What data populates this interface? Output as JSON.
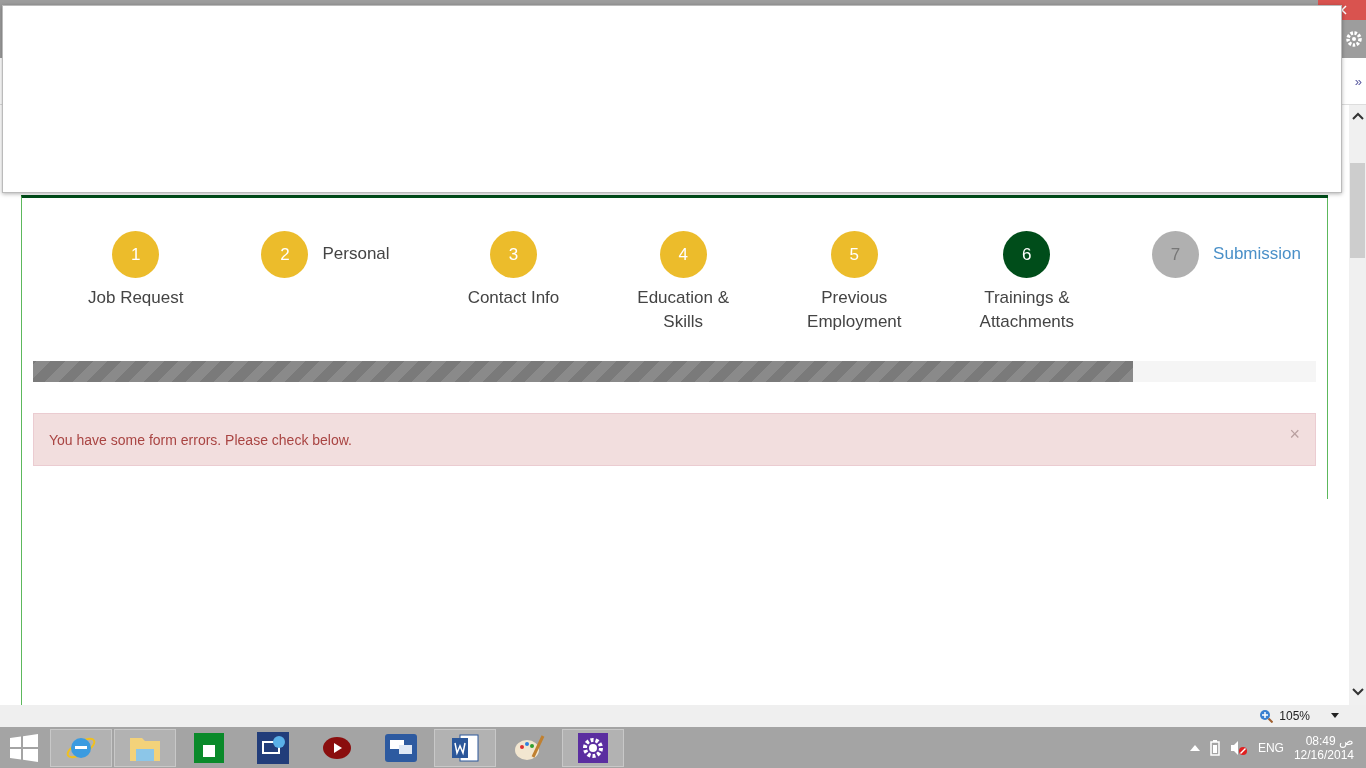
{
  "browser": {
    "toolbar_more": "»"
  },
  "steps": [
    {
      "number": "1",
      "label": "Job Request",
      "completed": true,
      "selected": false,
      "kind": "stacked"
    },
    {
      "number": "2",
      "label": "Personal",
      "completed": true,
      "selected": false,
      "kind": "inline"
    },
    {
      "number": "3",
      "label": "Contact Info",
      "completed": true,
      "selected": false,
      "kind": "stacked"
    },
    {
      "number": "4",
      "label": "Education &\nSkills",
      "completed": true,
      "selected": false,
      "kind": "stacked"
    },
    {
      "number": "5",
      "label": "Previous\nEmployment",
      "completed": true,
      "selected": false,
      "kind": "stacked"
    },
    {
      "number": "6",
      "label": "Trainings &\nAttachments",
      "completed": false,
      "selected": true,
      "kind": "stacked"
    },
    {
      "number": "7",
      "label": "Submission",
      "completed": false,
      "selected": false,
      "kind": "inline"
    }
  ],
  "progress": {
    "level": 0.857
  },
  "alert": {
    "message": "You have some form errors. Please check below.",
    "close": "×"
  },
  "status_bar": {
    "zoom": "105%"
  },
  "taskbar": {
    "apps": [
      {
        "kind": "ie",
        "open": true
      },
      {
        "kind": "explorer",
        "open": true
      },
      {
        "kind": "store",
        "open": false
      },
      {
        "kind": "remote",
        "open": false
      },
      {
        "kind": "video",
        "open": false
      },
      {
        "kind": "chat",
        "open": false
      },
      {
        "kind": "word",
        "open": true
      },
      {
        "kind": "paint",
        "open": false
      },
      {
        "kind": "settings",
        "open": true
      }
    ],
    "language": "ENG",
    "time": "08:49 ص",
    "date": "12/16/2014"
  }
}
